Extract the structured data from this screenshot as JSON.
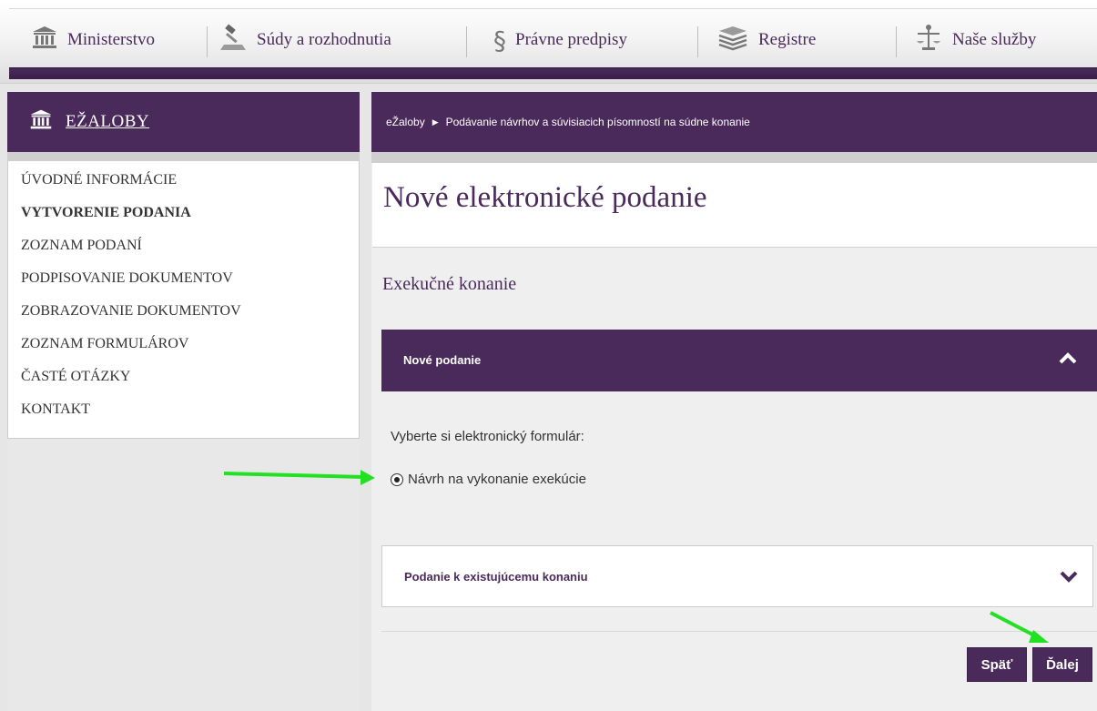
{
  "topnav": {
    "items": [
      {
        "label": "Ministerstvo",
        "icon": "building-icon"
      },
      {
        "label": "Súdy a rozhodnutia",
        "icon": "gavel-icon"
      },
      {
        "label": "Právne predpisy",
        "icon": "paragraph-icon"
      },
      {
        "label": "Registre",
        "icon": "stack-icon"
      },
      {
        "label": "Naše služby",
        "icon": "scales-icon"
      }
    ]
  },
  "sidebar": {
    "title": "EŽALOBY",
    "items": [
      {
        "label": "ÚVODNÉ INFORMÁCIE",
        "active": false
      },
      {
        "label": "VYTVORENIE PODANIA",
        "active": true
      },
      {
        "label": "ZOZNAM PODANÍ",
        "active": false
      },
      {
        "label": "PODPISOVANIE DOKUMENTOV",
        "active": false
      },
      {
        "label": "ZOBRAZOVANIE DOKUMENTOV",
        "active": false
      },
      {
        "label": "ZOZNAM FORMULÁROV",
        "active": false
      },
      {
        "label": "ČASTÉ OTÁZKY",
        "active": false
      },
      {
        "label": "KONTAKT",
        "active": false
      }
    ]
  },
  "breadcrumb": {
    "root": "eŽaloby",
    "current": "Podávanie návrhov a súvisiacich písomností na súdne konanie"
  },
  "main": {
    "page_title": "Nové elektronické podanie",
    "section_title": "Exekučné konanie",
    "accordion_new": {
      "label": "Nové podanie",
      "expanded": true
    },
    "choose_label": "Vyberte si elektronický formulár:",
    "radio_option": {
      "label": "Návrh na vykonanie exekúcie",
      "checked": true
    },
    "accordion_existing": {
      "label": "Podanie k existujúcemu konaniu",
      "expanded": false
    },
    "back_button": "Späť",
    "next_button": "Ďalej"
  },
  "colors": {
    "brand": "#4a2a5a",
    "annotation_arrow": "#22e022"
  }
}
